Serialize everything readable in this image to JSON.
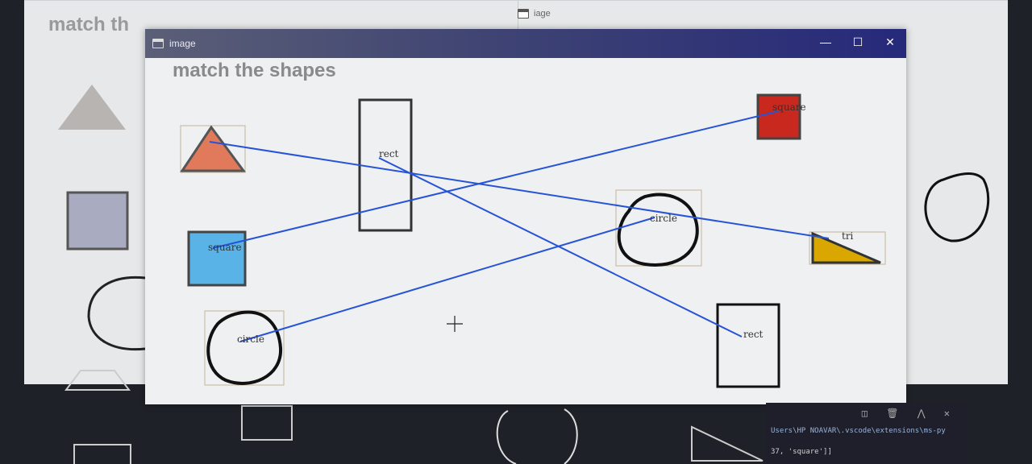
{
  "back_window": {
    "title_partial": "match th",
    "tab_label": "iage"
  },
  "main_window": {
    "title": "image",
    "canvas_title": "match the shapes",
    "controls": {
      "minimize": "—",
      "maximize": "☐",
      "close": "✕"
    }
  },
  "left_shapes": [
    {
      "shape": "triangle",
      "color": "#e07a5a"
    },
    {
      "shape": "square",
      "label": "square",
      "color": "#5ab3e6"
    },
    {
      "shape": "circle",
      "label": "circle"
    }
  ],
  "right_shapes": [
    {
      "shape": "square",
      "label": "square",
      "color": "#c8281e"
    },
    {
      "shape": "circle",
      "label": "circle"
    },
    {
      "shape": "triangle",
      "label": "tri",
      "color": "#d9a700"
    },
    {
      "shape": "rect",
      "label": "rect"
    }
  ],
  "middle_shapes": [
    {
      "shape": "rect",
      "label": "rect"
    }
  ],
  "cursor": "+",
  "terminal": {
    "icons": "◫ 🗑 ⋀ ✕",
    "line1": "Users\\HP NOAVAR\\.vscode\\extensions\\ms-py",
    "line2": "37, 'square']]"
  },
  "colors": {
    "match_line": "#2753d6",
    "title_bar": "#3f4473"
  }
}
